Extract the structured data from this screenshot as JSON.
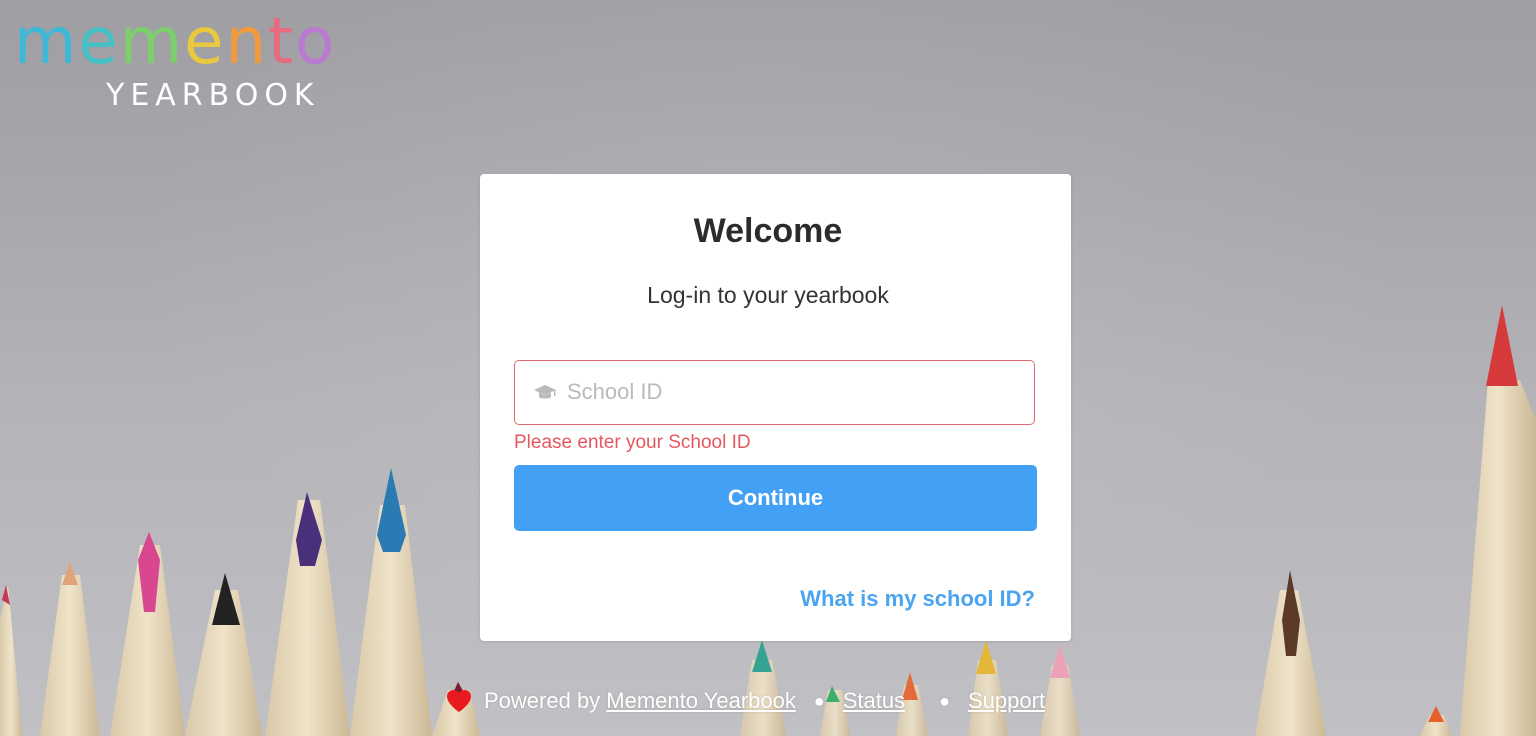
{
  "logo": {
    "word_letters": [
      "m",
      "e",
      "m",
      "e",
      "n",
      "t",
      "o"
    ],
    "word_colors": [
      "#3fb8d8",
      "#45c0c6",
      "#7ccf6a",
      "#e9c93e",
      "#f19a3e",
      "#e86a7e",
      "#b97ad0"
    ],
    "subtitle": "YEARBOOK"
  },
  "card": {
    "title": "Welcome",
    "subtitle": "Log-in to your yearbook",
    "school_id": {
      "icon": "graduation-cap-icon",
      "placeholder": "School ID",
      "value": "",
      "error": "Please enter your School ID"
    },
    "continue_label": "Continue",
    "help_link": "What is my school ID?"
  },
  "footer": {
    "heart_icon": "heart-icon",
    "powered_by": "Powered by ",
    "powered_link": "Memento Yearbook",
    "status_link": "Status",
    "support_link": "Support"
  },
  "colors": {
    "accent": "#42a1f5",
    "error": "#e5585f",
    "heart": "#e8191f"
  }
}
